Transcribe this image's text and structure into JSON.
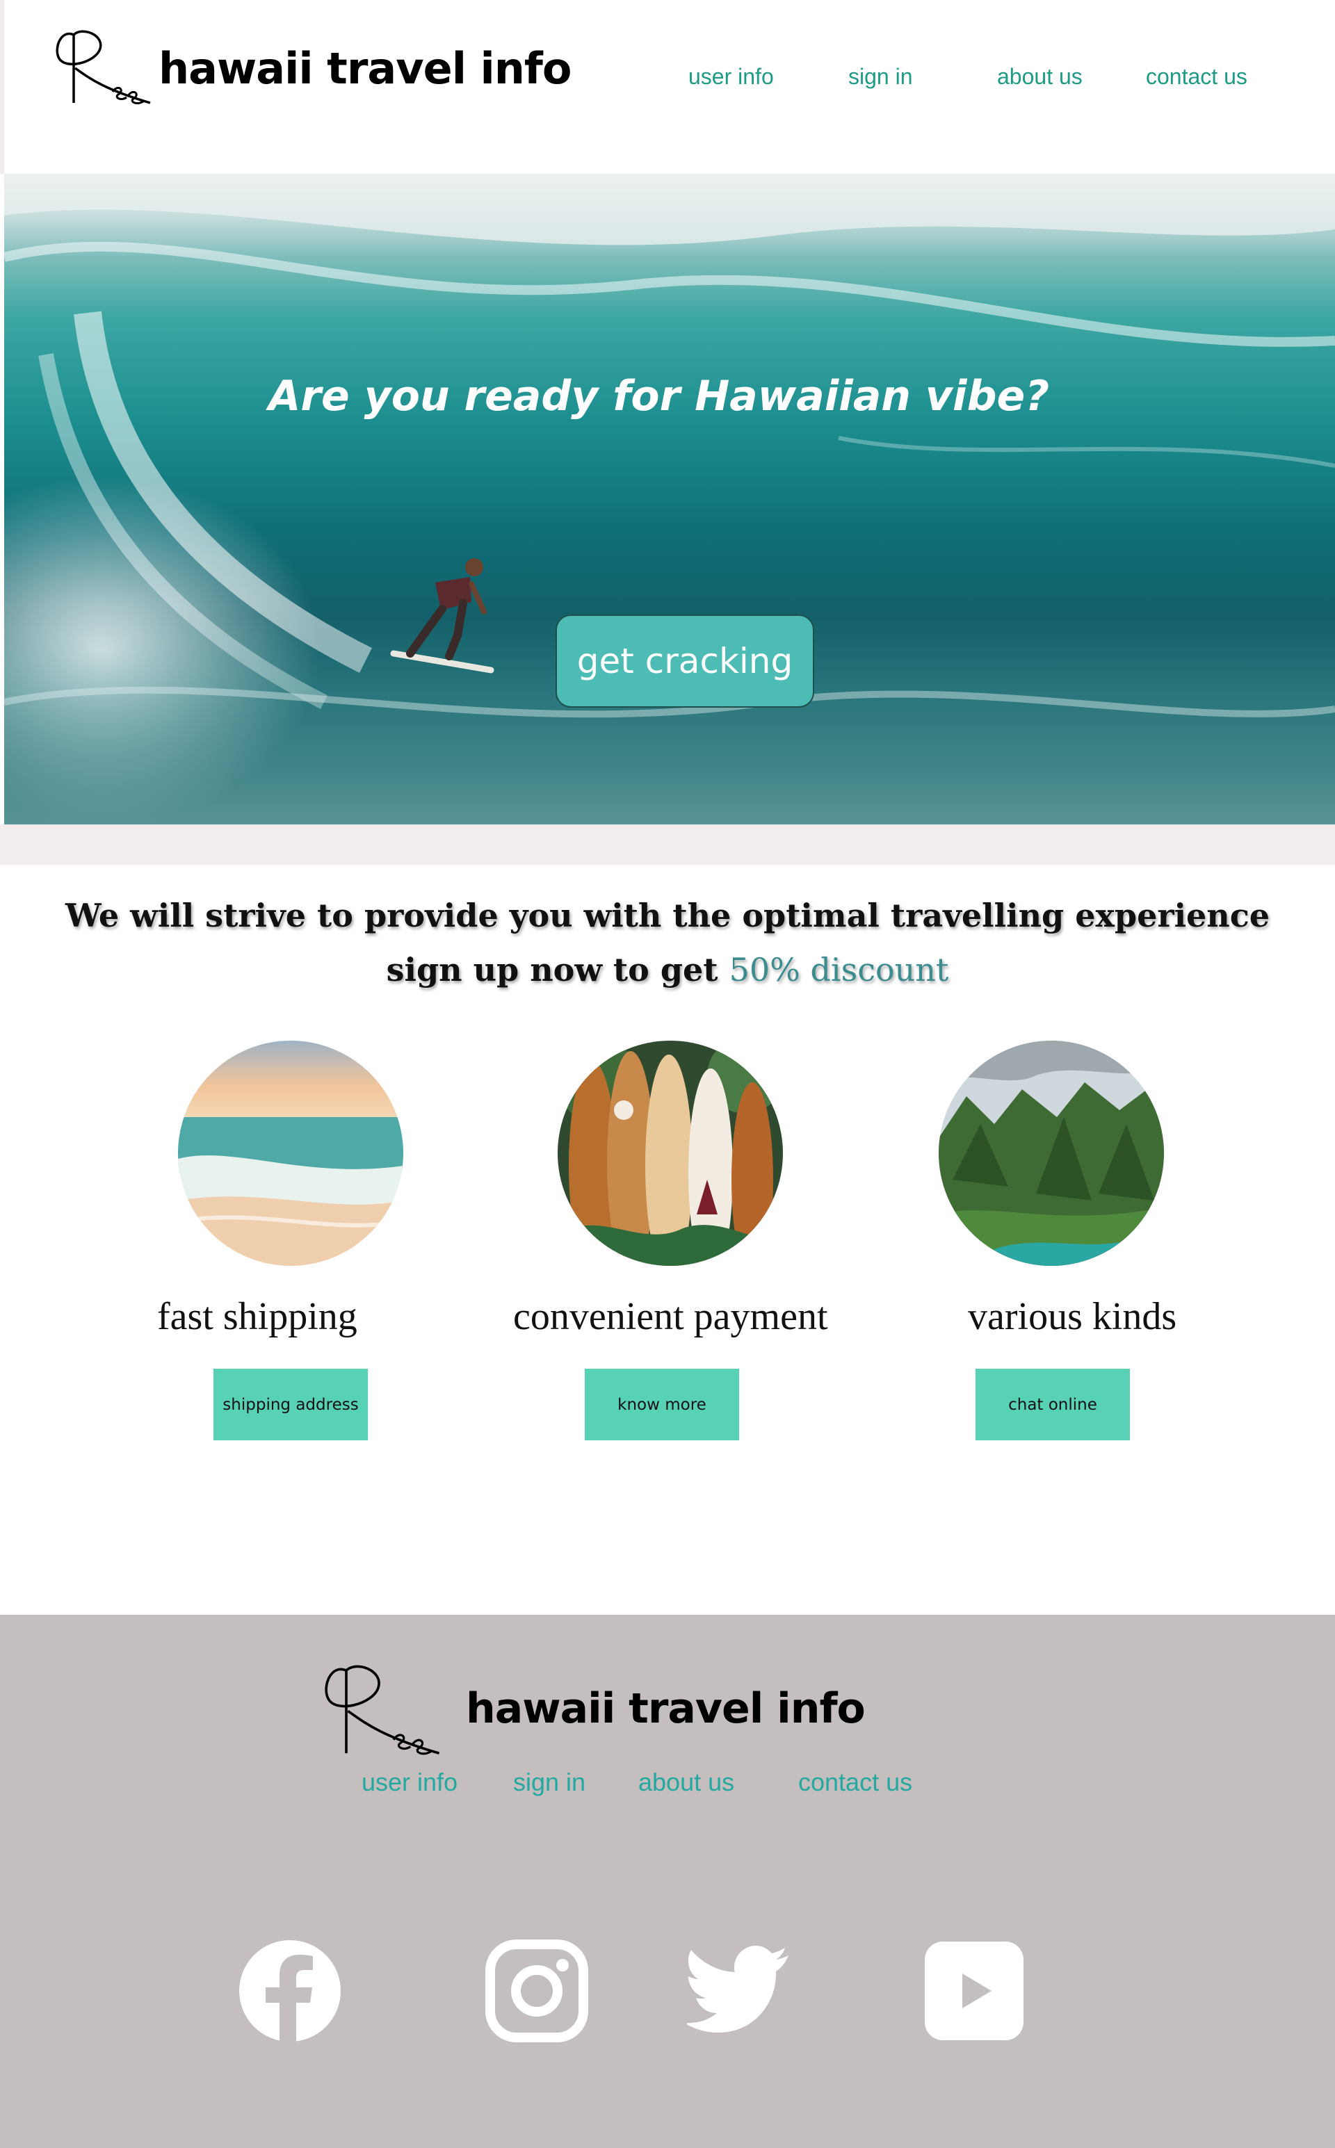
{
  "header": {
    "logo_icon": "ree-signature-logo",
    "title": "hawaii travel info",
    "nav": [
      "user info",
      "sign in",
      "about us",
      "contact us"
    ]
  },
  "hero": {
    "heading": "Are you ready for Hawaiian vibe?",
    "cta_label": "get cracking",
    "image": "surfer-riding-turquoise-wave"
  },
  "tagline": {
    "line1": "We will strive to provide you with the optimal travelling experience",
    "line2_prefix": "sign up now to get ",
    "line2_accent": "50% discount"
  },
  "features": [
    {
      "image": "beach-sunset-photo",
      "title": "fast shipping",
      "button": "shipping address"
    },
    {
      "image": "surfboards-photo",
      "title": "convenient payment",
      "button": "know more"
    },
    {
      "image": "green-mountains-coast-photo",
      "title": "various kinds",
      "button": "chat online"
    }
  ],
  "footer": {
    "logo_icon": "ree-signature-logo",
    "title": "hawaii travel info",
    "nav": [
      "user info",
      "sign in",
      "about us",
      "contact us"
    ],
    "social_icons": [
      "facebook-icon",
      "instagram-icon",
      "twitter-icon",
      "youtube-icon"
    ]
  },
  "colors": {
    "nav_text": "#1e9b84",
    "footer_nav_text": "#24a8a0",
    "cta_bg": "#4cbcb4",
    "feature_button_bg": "#57d2b5",
    "footer_bg": "#c4bebe",
    "accent_text": "#3b8c8e"
  }
}
